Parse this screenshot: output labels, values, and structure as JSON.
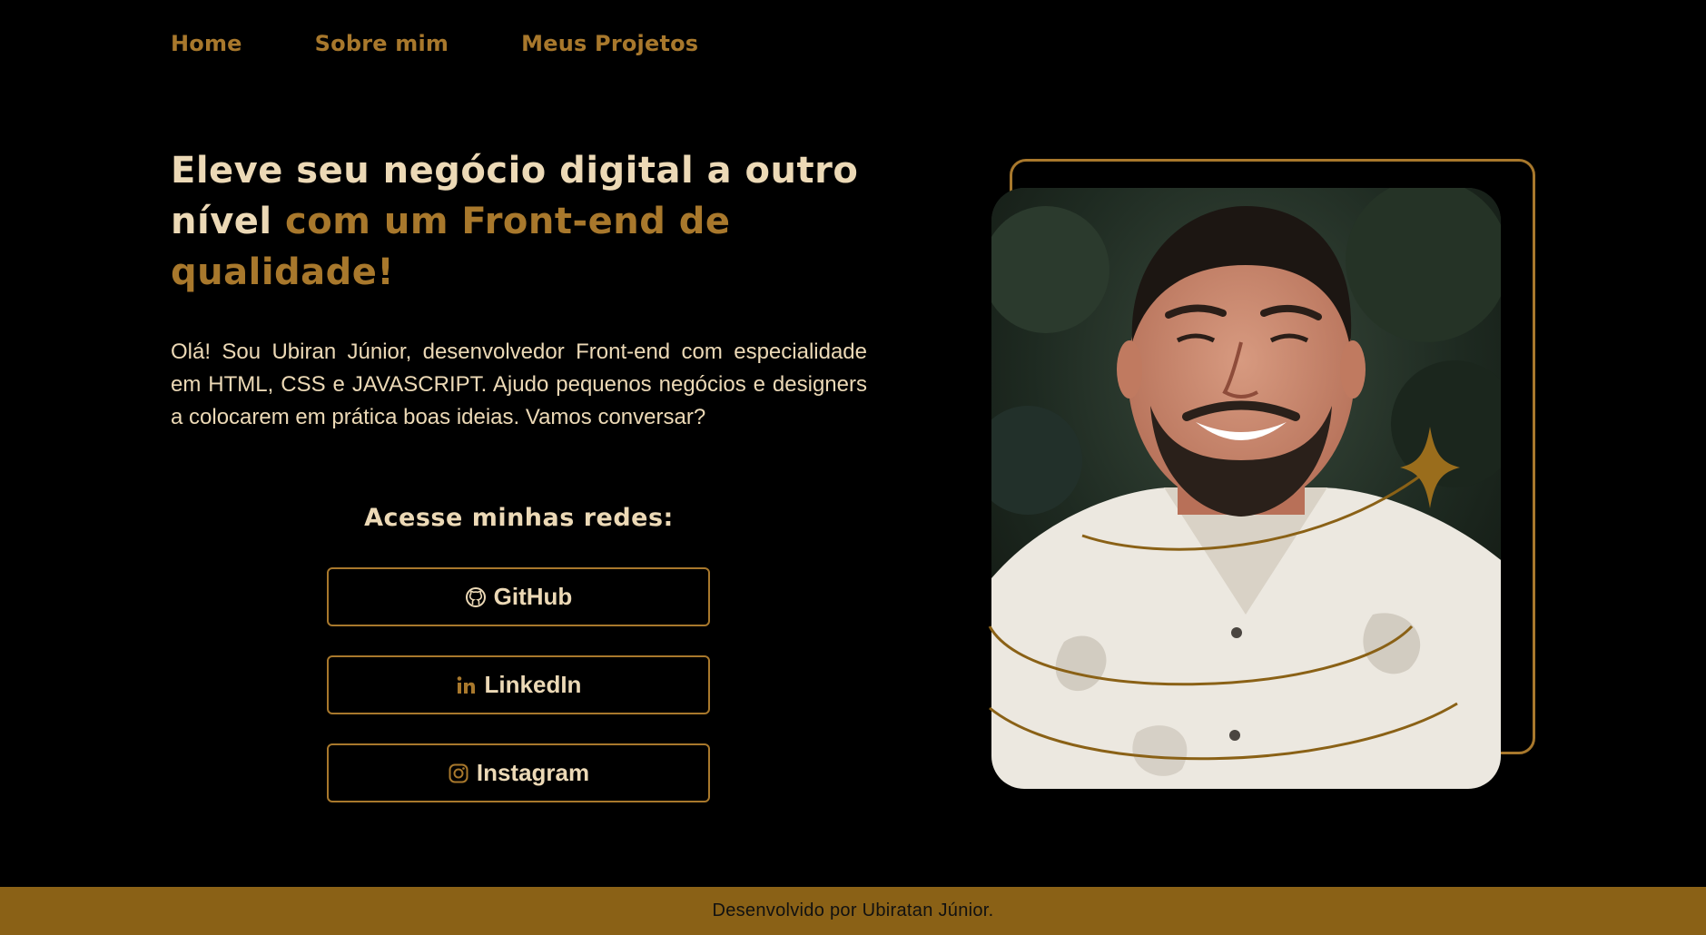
{
  "nav": {
    "items": [
      {
        "label": "Home"
      },
      {
        "label": "Sobre mim"
      },
      {
        "label": "Meus Projetos"
      }
    ]
  },
  "hero": {
    "title_part1": "Eleve seu negócio digital a outro nível",
    "title_part2": "com um Front-end de qualidade!",
    "description": "Olá! Sou Ubiran Júnior, desenvolvedor Front-end com especialidade em HTML, CSS e JAVASCRIPT. Ajudo pequenos negócios e designers a colocarem em prática boas ideias. Vamos conversar?"
  },
  "socials": {
    "title": "Acesse minhas redes:",
    "buttons": [
      {
        "label": "GitHub",
        "icon": "github-icon"
      },
      {
        "label": "LinkedIn",
        "icon": "linkedin-icon"
      },
      {
        "label": "Instagram",
        "icon": "instagram-icon"
      }
    ]
  },
  "footer": {
    "text": "Desenvolvido por Ubiratan Júnior."
  },
  "colors": {
    "background": "#000000",
    "accent": "#a8782c",
    "text_light": "#ecd9b6",
    "footer_bg": "#8a6116"
  }
}
